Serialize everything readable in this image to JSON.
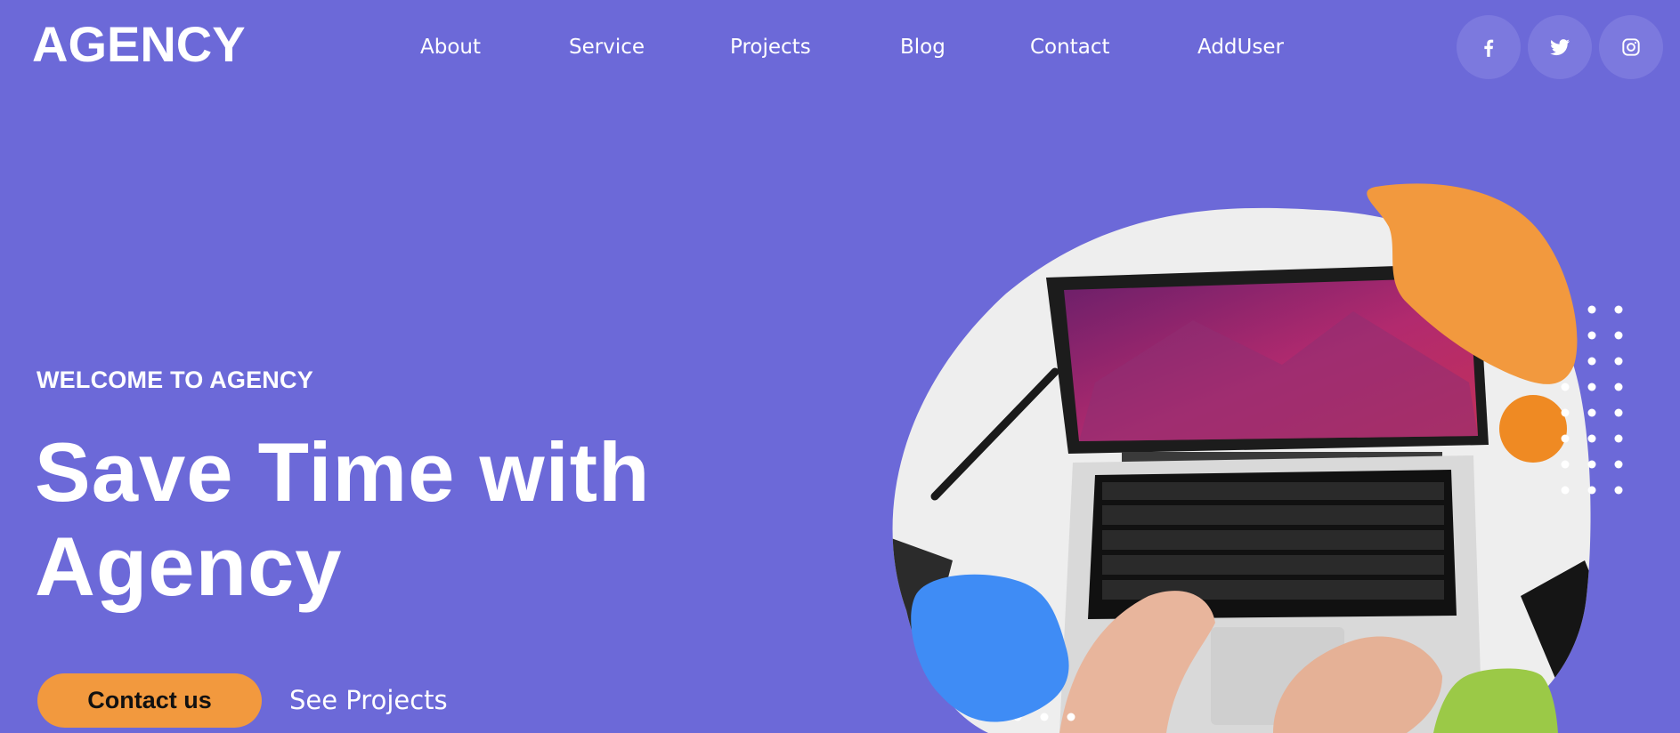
{
  "brand": {
    "logo_text": "AGENCY"
  },
  "nav": {
    "items": [
      {
        "label": "About"
      },
      {
        "label": "Service"
      },
      {
        "label": "Projects"
      },
      {
        "label": "Blog"
      },
      {
        "label": "Contact"
      },
      {
        "label": "AddUser"
      }
    ],
    "social": [
      {
        "icon": "facebook-icon"
      },
      {
        "icon": "twitter-icon"
      },
      {
        "icon": "instagram-icon"
      }
    ]
  },
  "hero": {
    "eyebrow": "WELCOME TO AGENCY",
    "headline_line1": "Save Time with",
    "headline_line2": "Agency",
    "primary_button": "Contact us",
    "secondary_link": "See Projects"
  },
  "colors": {
    "background": "#6c69d8",
    "accent_orange": "#f2993e",
    "accent_blue": "#3f8cf5",
    "accent_green": "#9bc947",
    "social_circle": "#7c79de"
  }
}
